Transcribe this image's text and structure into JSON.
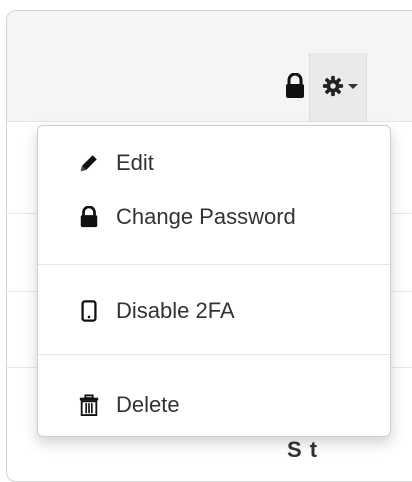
{
  "toolbar": {
    "lock_icon": "lock-icon",
    "settings_icon": "gear-icon",
    "dropdown_caret": "chevron-down-icon"
  },
  "menu": {
    "items": [
      {
        "label": "Edit",
        "icon": "pencil-icon"
      },
      {
        "label": "Change Password",
        "icon": "lock-icon"
      },
      {
        "label": "Disable 2FA",
        "icon": "mobile-phone-icon"
      },
      {
        "label": "Delete",
        "icon": "trash-icon"
      }
    ]
  },
  "background": {
    "cutoff_text": "S  t"
  },
  "colors": {
    "text": "#333333",
    "toolbar_bg": "#f5f5f5",
    "menu_border": "#cfcfcf"
  }
}
